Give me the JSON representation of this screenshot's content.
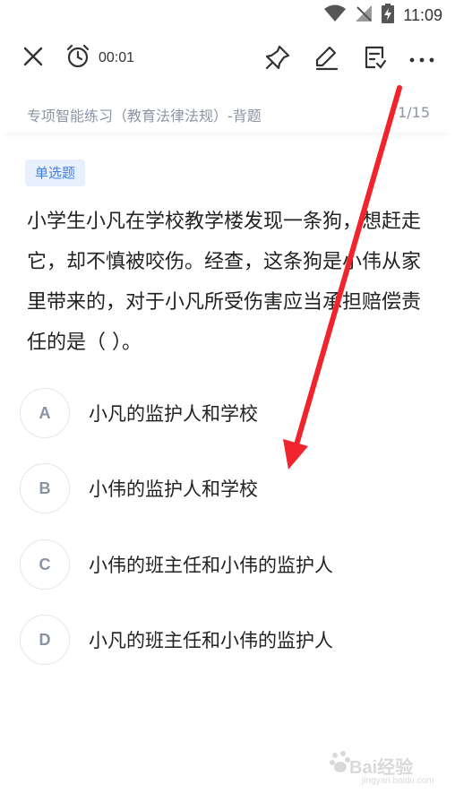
{
  "status_bar": {
    "time": "11:09",
    "icons": [
      "wifi-icon",
      "no-signal-icon",
      "battery-charging-icon"
    ]
  },
  "toolbar": {
    "close_icon": "close-icon",
    "timer_icon": "alarm-clock-icon",
    "timer": "00:01",
    "actions": [
      "pin-icon",
      "edit-icon",
      "note-icon",
      "more-icon"
    ]
  },
  "header": {
    "title": "专项智能练习（教育法律法规）-背题",
    "progress": "1/15"
  },
  "question": {
    "type": "单选题",
    "text": "小学生小凡在学校教学楼发现一条狗，想赶走它，却不慎被咬伤。经查，这条狗是小伟从家里带来的，对于小凡所受伤害应当承担赔偿责任的是（ ）。",
    "options": [
      {
        "letter": "A",
        "text": "小凡的监护人和学校"
      },
      {
        "letter": "B",
        "text": "小伟的监护人和学校"
      },
      {
        "letter": "C",
        "text": "小伟的班主任和小伟的监护人"
      },
      {
        "letter": "D",
        "text": "小凡的班主任和小伟的监护人"
      }
    ]
  },
  "colors": {
    "accent": "#3d7ff0",
    "tag_bg": "#e8f0fd",
    "muted": "#8d95a5",
    "annotation_arrow": "#f0242c"
  },
  "watermark": {
    "text": "Bai经验",
    "sub": "jingyan.baidu.com"
  }
}
